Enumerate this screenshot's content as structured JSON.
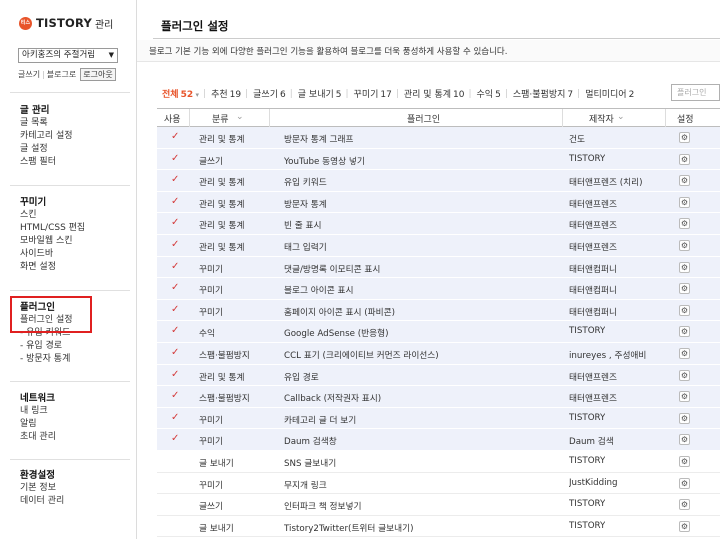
{
  "brand": {
    "logo": "티스",
    "name": "TISTORY",
    "suffix": "관리"
  },
  "blog_select": {
    "value": "아키홍즈의 주절거림"
  },
  "quick_links": {
    "write": "글쓰기",
    "blog": "블로그로",
    "logout": "로그아웃"
  },
  "sidebar": {
    "groups": [
      {
        "heading": "글 관리",
        "items": [
          "글 목록",
          "카테고리 설정",
          "글 설정",
          "스팸 필터"
        ]
      },
      {
        "heading": "꾸미기",
        "items": [
          "스킨",
          "HTML/CSS 편집",
          "모바일웹 스킨",
          "사이드바",
          "화면 설정"
        ]
      },
      {
        "heading": "플러그인",
        "items": [
          "플러그인 설정",
          "- 유입 키워드",
          "- 유입 경로",
          "- 방문자 통계"
        ]
      },
      {
        "heading": "네트워크",
        "items": [
          "내 링크",
          "알림",
          "초대 관리"
        ]
      },
      {
        "heading": "환경설정",
        "items": [
          "기본 정보",
          "데이터 관리"
        ]
      }
    ]
  },
  "main": {
    "title": "플러그인 설정",
    "description": "블로그 기본 기능 외에 다양한 플러그인 기능을 활용하여 블로그를 더욱 풍성하게 사용할 수 있습니다.",
    "filters": [
      {
        "label": "전체",
        "count": "52",
        "active": true
      },
      {
        "label": "추천",
        "count": "19"
      },
      {
        "label": "글쓰기",
        "count": "6"
      },
      {
        "label": "글 보내기",
        "count": "5"
      },
      {
        "label": "꾸미기",
        "count": "17"
      },
      {
        "label": "관리 및 통계",
        "count": "10"
      },
      {
        "label": "수익",
        "count": "5"
      },
      {
        "label": "스팸·불펌방지",
        "count": "7"
      },
      {
        "label": "멀티미디어",
        "count": "2"
      }
    ],
    "search_placeholder": "플러그인",
    "columns": {
      "use": "사용",
      "category": "분류",
      "plugin": "플러그인",
      "author": "제작자",
      "settings": "설정"
    },
    "rows": [
      {
        "on": true,
        "category": "관리 및 통계",
        "plugin": "방문자 통계 그래프",
        "author": "건도"
      },
      {
        "on": true,
        "category": "글쓰기",
        "plugin": "YouTube 동영상 넣기",
        "author": "TISTORY"
      },
      {
        "on": true,
        "category": "관리 및 통계",
        "plugin": "유입 키워드",
        "author": "태터앤프렌즈 (치리)"
      },
      {
        "on": true,
        "category": "관리 및 통계",
        "plugin": "방문자 통계",
        "author": "태터앤프렌즈"
      },
      {
        "on": true,
        "category": "관리 및 통계",
        "plugin": "빈 줄 표시",
        "author": "태터앤프렌즈"
      },
      {
        "on": true,
        "category": "관리 및 통계",
        "plugin": "태그 입력기",
        "author": "태터앤프렌즈"
      },
      {
        "on": true,
        "category": "꾸미기",
        "plugin": "댓글/방명록 이모티콘 표시",
        "author": "태터앤컴퍼니"
      },
      {
        "on": true,
        "category": "꾸미기",
        "plugin": "블로그 아이콘 표시",
        "author": "태터앤컴퍼니"
      },
      {
        "on": true,
        "category": "꾸미기",
        "plugin": "홈페이지 아이콘 표시 (파비콘)",
        "author": "태터앤컴퍼니"
      },
      {
        "on": true,
        "category": "수익",
        "plugin": "Google AdSense (반응형)",
        "author": "TISTORY"
      },
      {
        "on": true,
        "category": "스팸·불펌방지",
        "plugin": "CCL 표기 (크리에이티브 커먼즈 라이선스)",
        "author": "inureyes , 주성애비"
      },
      {
        "on": true,
        "category": "관리 및 통계",
        "plugin": "유입 경로",
        "author": "태터앤프렌즈"
      },
      {
        "on": true,
        "category": "스팸·불펌방지",
        "plugin": "Callback (저작권자 표시)",
        "author": "태터앤프렌즈"
      },
      {
        "on": true,
        "category": "꾸미기",
        "plugin": "카테고리 글 더 보기",
        "author": "TISTORY"
      },
      {
        "on": true,
        "category": "꾸미기",
        "plugin": "Daum 검색창",
        "author": "Daum 검색"
      },
      {
        "on": false,
        "category": "글 보내기",
        "plugin": "SNS 글보내기",
        "author": "TISTORY"
      },
      {
        "on": false,
        "category": "꾸미기",
        "plugin": "무지개 링크",
        "author": "JustKidding"
      },
      {
        "on": false,
        "category": "글쓰기",
        "plugin": "인터파크 책 정보넣기",
        "author": "TISTORY"
      },
      {
        "on": false,
        "category": "글 보내기",
        "plugin": "Tistory2Twitter(트위터 글보내기)",
        "author": "TISTORY"
      }
    ],
    "check_glyph": "✓",
    "gear_glyph": "⚙"
  },
  "colors": {
    "accent": "#e8542a",
    "highlight": "#e02020",
    "active_row": "#eef1fa",
    "check": "#d43a3a"
  }
}
